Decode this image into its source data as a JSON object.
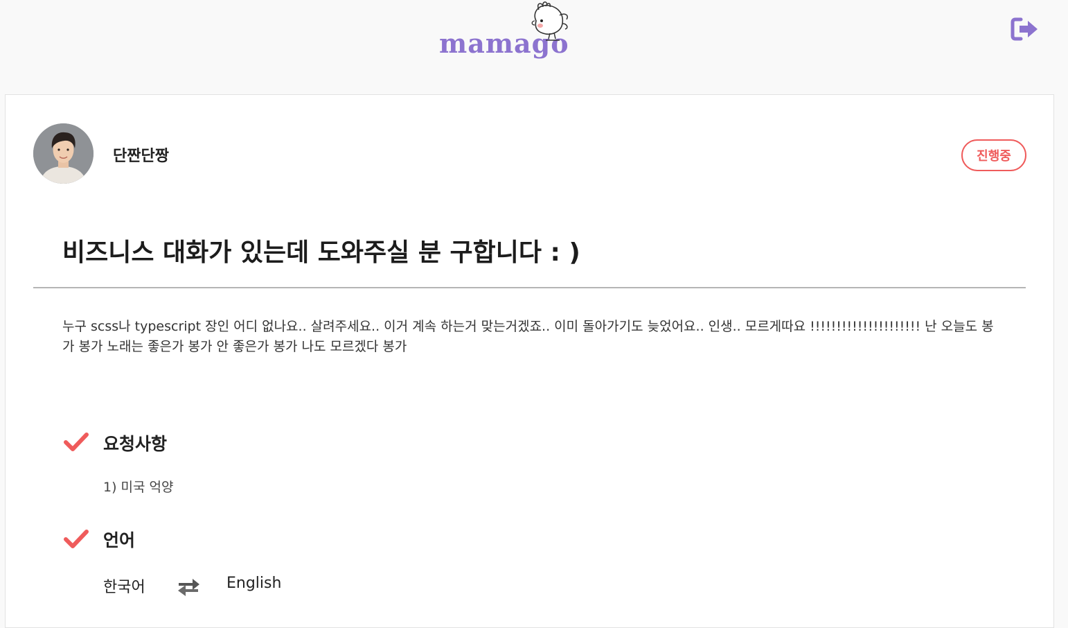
{
  "header": {
    "logo_text": "mamago",
    "logout_icon": "sign-out-icon",
    "accent_color": "#8c73cf"
  },
  "post": {
    "username": "단짠단짱",
    "status": "진행중",
    "status_color": "#ef5b5b",
    "title": "비즈니스 대화가 있는데 도와주실 분 구합니다 : )",
    "body": "누구 scss나 typescript 장인 어디 없나요.. 살려주세요.. 이거 계속 하는거 맞는거겠죠.. 이미 돌아가기도 늦었어요.. 인생.. 모르게따요 !!!!!!!!!!!!!!!!!!!!! 난 오늘도 봉가 봉가 노래는 좋은가 봉가 안 좋은가 봉가 나도 모르겠다 봉가"
  },
  "requests": {
    "title": "요청사항",
    "items": [
      "1) 미국 억양"
    ]
  },
  "language": {
    "title": "언어",
    "from": "한국어",
    "to": "English",
    "swap_icon": "exchange-arrows-icon"
  }
}
